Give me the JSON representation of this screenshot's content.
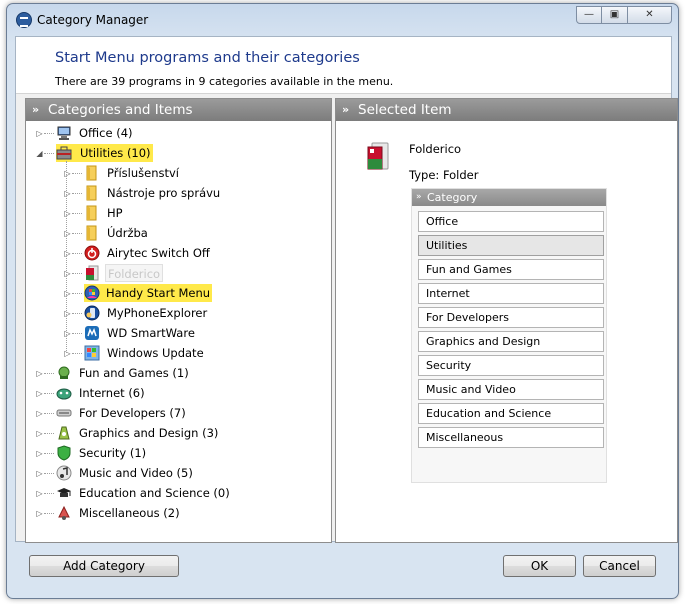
{
  "window": {
    "title": "Category Manager",
    "caption_min": "—",
    "caption_max": "▣",
    "caption_close": "✕"
  },
  "header": {
    "title": "Start Menu programs and their categories",
    "subtitle": "There are 39 programs in 9 categories available in the menu."
  },
  "left_pane": {
    "title": "Categories and Items",
    "tree": [
      {
        "label": "Office (4)",
        "level": 0,
        "icon": "office-computer-icon",
        "highlight": false
      },
      {
        "label": "Utilities (10)",
        "level": 0,
        "icon": "utilities-toolbox-icon",
        "highlight": true,
        "expanded": true
      },
      {
        "label": "Příslušenství",
        "level": 1,
        "icon": "folder-icon",
        "highlight": false
      },
      {
        "label": "Nástroje pro správu",
        "level": 1,
        "icon": "folder-icon",
        "highlight": false
      },
      {
        "label": "HP",
        "level": 1,
        "icon": "folder-icon",
        "highlight": false
      },
      {
        "label": "Údržba",
        "level": 1,
        "icon": "folder-icon",
        "highlight": false
      },
      {
        "label": "Airytec Switch Off",
        "level": 1,
        "icon": "power-switch-icon",
        "highlight": false
      },
      {
        "label": "Folderico",
        "level": 1,
        "icon": "folderico-icon",
        "highlight": false,
        "ghost": true
      },
      {
        "label": "Handy Start Menu",
        "level": 1,
        "icon": "handy-start-menu-icon",
        "highlight": true
      },
      {
        "label": "MyPhoneExplorer",
        "level": 1,
        "icon": "phone-explorer-icon",
        "highlight": false
      },
      {
        "label": "WD SmartWare",
        "level": 1,
        "icon": "wd-smartware-icon",
        "highlight": false
      },
      {
        "label": "Windows Update",
        "level": 1,
        "icon": "windows-update-icon",
        "highlight": false
      },
      {
        "label": "Fun and Games (1)",
        "level": 0,
        "icon": "games-icon",
        "highlight": false
      },
      {
        "label": "Internet (6)",
        "level": 0,
        "icon": "internet-icon",
        "highlight": false
      },
      {
        "label": "For Developers (7)",
        "level": 0,
        "icon": "developers-icon",
        "highlight": false
      },
      {
        "label": "Graphics and Design (3)",
        "level": 0,
        "icon": "graphics-icon",
        "highlight": false
      },
      {
        "label": "Security (1)",
        "level": 0,
        "icon": "security-shield-icon",
        "highlight": false
      },
      {
        "label": "Music and Video (5)",
        "level": 0,
        "icon": "music-note-icon",
        "highlight": false
      },
      {
        "label": "Education and Science (0)",
        "level": 0,
        "icon": "graduation-cap-icon",
        "highlight": false
      },
      {
        "label": "Miscellaneous (2)",
        "level": 0,
        "icon": "misc-icon",
        "highlight": false
      }
    ]
  },
  "right_pane": {
    "title": "Selected Item",
    "item_name": "Folderico",
    "item_type": "Type: Folder",
    "category_header": "Category",
    "categories": [
      {
        "label": "Office",
        "selected": false
      },
      {
        "label": "Utilities",
        "selected": true
      },
      {
        "label": "Fun and Games",
        "selected": false
      },
      {
        "label": "Internet",
        "selected": false
      },
      {
        "label": "For Developers",
        "selected": false
      },
      {
        "label": "Graphics and Design",
        "selected": false
      },
      {
        "label": "Security",
        "selected": false
      },
      {
        "label": "Music and Video",
        "selected": false
      },
      {
        "label": "Education and Science",
        "selected": false
      },
      {
        "label": "Miscellaneous",
        "selected": false
      }
    ]
  },
  "buttons": {
    "add_category": "Add Category",
    "ok": "OK",
    "cancel": "Cancel"
  },
  "colors": {
    "highlight": "#ffe94a",
    "header_title": "#1e3a8c",
    "pane_header": "#8a8a8a"
  }
}
